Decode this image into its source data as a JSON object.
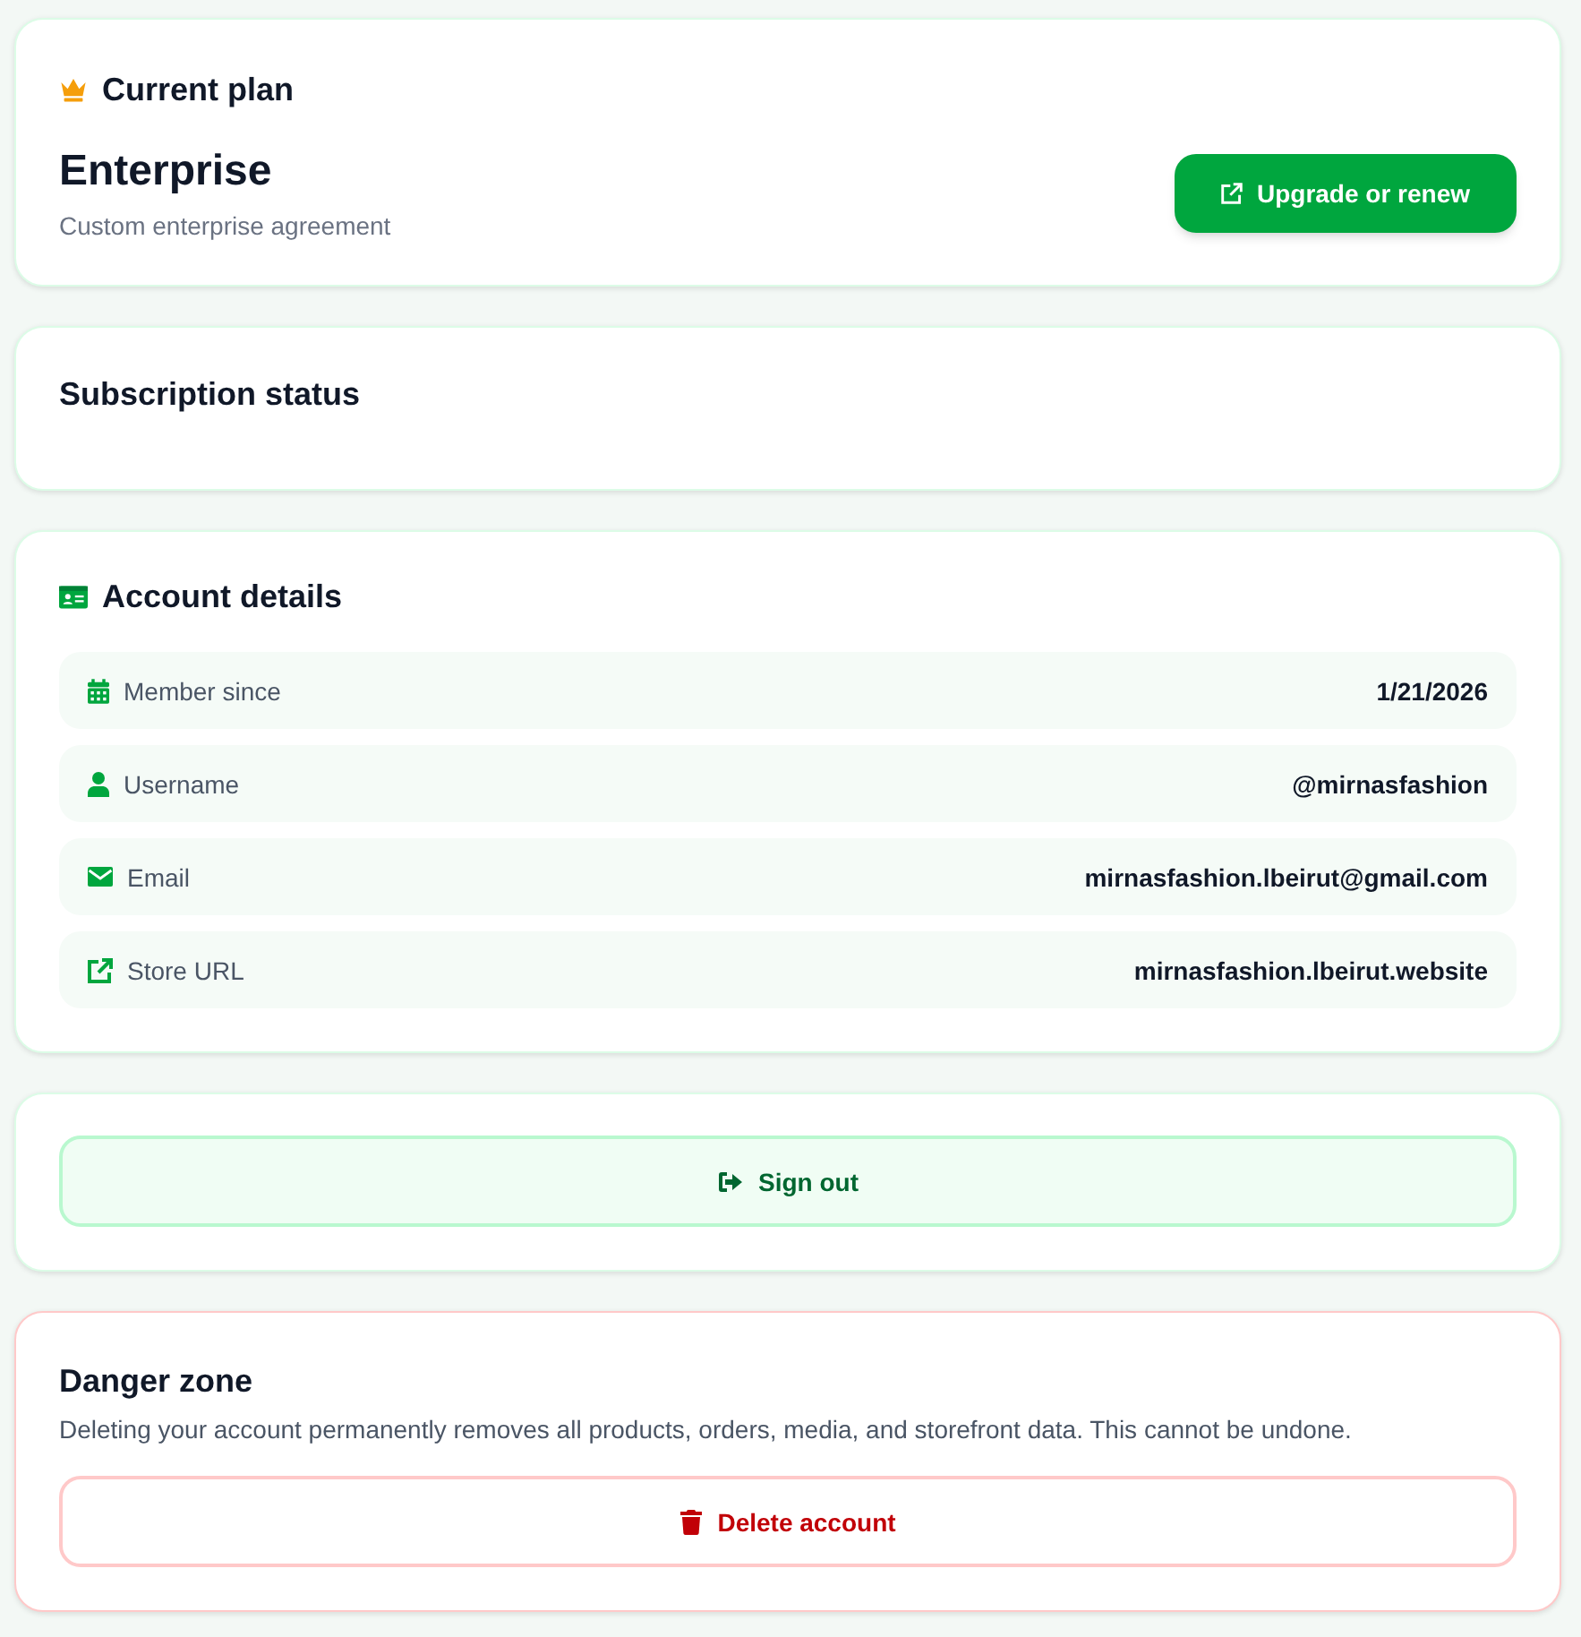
{
  "current_plan": {
    "title": "Current plan",
    "plan_name": "Enterprise",
    "description": "Custom enterprise agreement",
    "button": {
      "label": "Upgrade or renew"
    }
  },
  "subscription_status": {
    "title": "Subscription status"
  },
  "account_details": {
    "title": "Account details",
    "rows": [
      {
        "kind": "date",
        "label": "Member since",
        "value": "1/21/2026"
      },
      {
        "kind": "user",
        "label": "Username",
        "value": "@mirnasfashion"
      },
      {
        "kind": "email",
        "label": "Email",
        "value": "mirnasfashion.lbeirut@gmail.com"
      },
      {
        "kind": "link",
        "label": "Store URL",
        "value": "mirnasfashion.lbeirut.website"
      }
    ]
  },
  "sign_out": {
    "label": "Sign out"
  },
  "danger_zone": {
    "title": "Danger zone",
    "description": "Deleting your account permanently removes all products, orders, media, and storefront data. This cannot be undone.",
    "button": {
      "label": "Delete account"
    }
  }
}
